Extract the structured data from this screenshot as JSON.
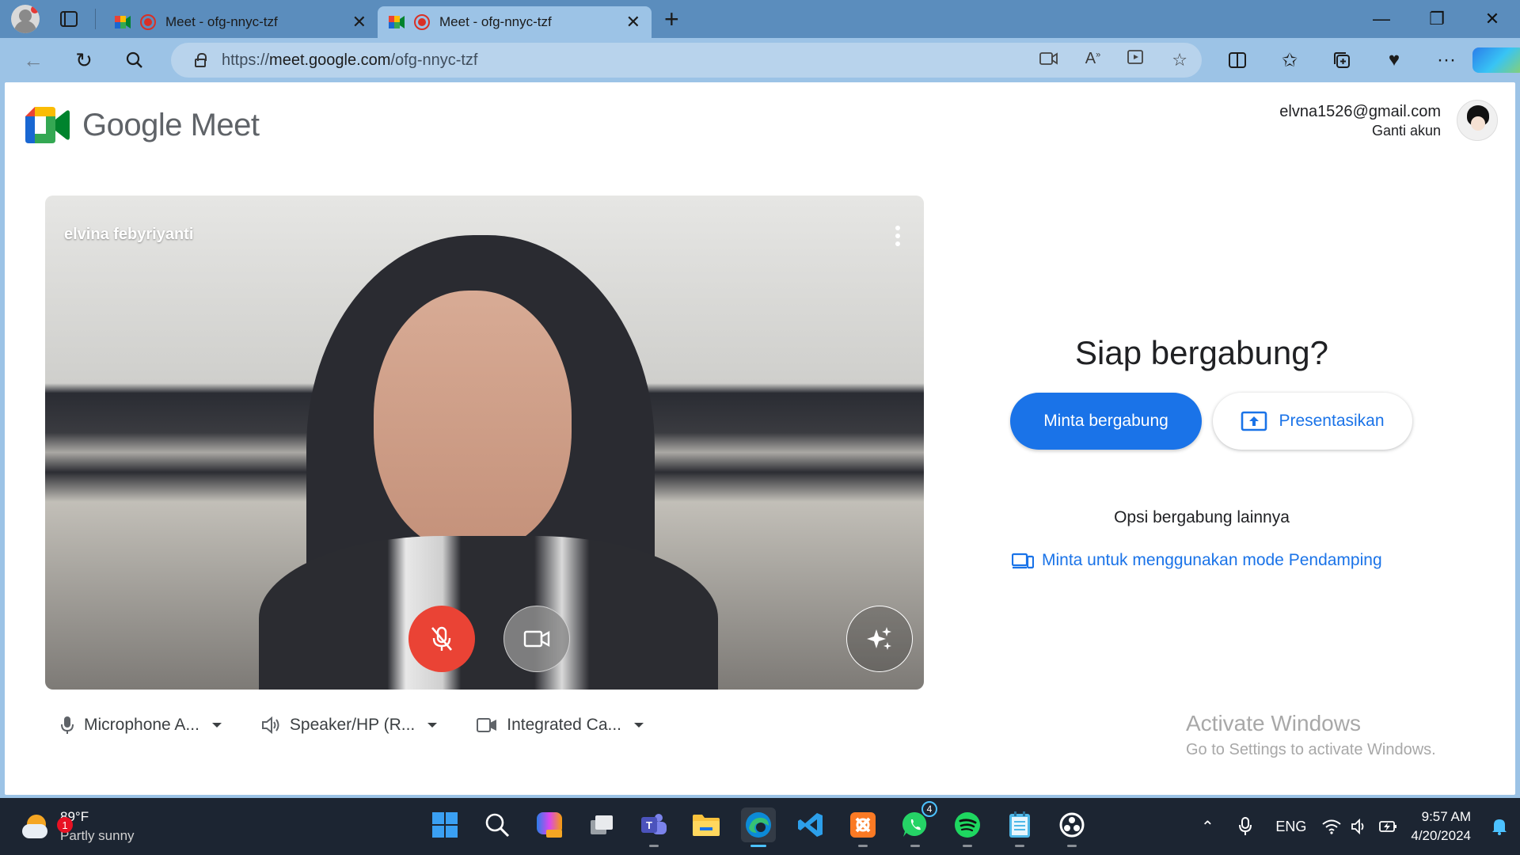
{
  "browser": {
    "tabs": [
      {
        "title": "Meet - ofg-nnyc-tzf",
        "active": false
      },
      {
        "title": "Meet - ofg-nnyc-tzf",
        "active": true
      }
    ],
    "new_tab_symbol": "+",
    "window_controls": {
      "minimize": "—",
      "restore": "❐",
      "close": "✕"
    },
    "url": {
      "prefix": "https://",
      "host": "meet.google.com",
      "path": "/ofg-nnyc-tzf"
    }
  },
  "meet": {
    "brand": "Google Meet",
    "account": {
      "email": "elvna1526@gmail.com",
      "switch_label": "Ganti akun"
    },
    "preview": {
      "participant_name": "elvina febyriyanti",
      "mic_muted": true
    },
    "devices": {
      "microphone": "Microphone A...",
      "speaker": "Speaker/HP (R...",
      "camera": "Integrated Ca..."
    },
    "ready_title": "Siap bergabung?",
    "join_button": "Minta bergabung",
    "present_button": "Presentasikan",
    "other_options": "Opsi bergabung lainnya",
    "companion_link": "Minta untuk menggunakan mode Pendamping",
    "colors": {
      "primary": "#1a73e8",
      "mic_off": "#ea4335"
    }
  },
  "watermark": {
    "line1": "Activate Windows",
    "line2": "Go to Settings to activate Windows."
  },
  "taskbar": {
    "weather": {
      "temp": "89°F",
      "condition": "Partly sunny",
      "badge": "1"
    },
    "whatsapp_badge": "4",
    "tray": {
      "language": "ENG"
    },
    "clock": {
      "time": "9:57 AM",
      "date": "4/20/2024"
    }
  }
}
